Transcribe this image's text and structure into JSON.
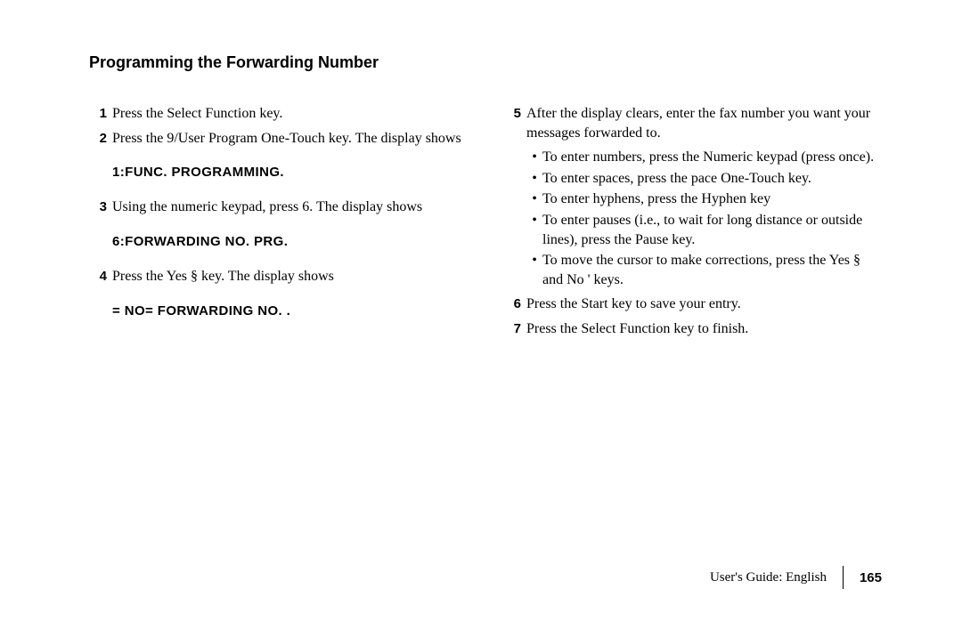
{
  "heading": "Programming the Forwarding Number",
  "left": {
    "steps": [
      {
        "n": "1",
        "t": "Press the Select Function key."
      },
      {
        "n": "2",
        "t": "Press the 9/User Program One-Touch key. The display shows"
      }
    ],
    "display1": "1:FUNC. PROGRAMMING.",
    "step3": {
      "n": "3",
      "t": "Using the numeric keypad, press 6. The display shows"
    },
    "display2": "6:FORWARDING NO. PRG.",
    "step4": {
      "n": "4",
      "t": "Press the Yes §   key. The display shows"
    },
    "display3": "=  NO=   FORWARDING NO.   ."
  },
  "right": {
    "step5": {
      "n": "5",
      "t": "After the display clears, enter the fax number you want your messages forwarded to."
    },
    "bullets": [
      "To enter numbers, press the Numeric keypad (press once).",
      "To enter spaces, press the pace One-Touch key.",
      "To enter hyphens, press the Hyphen key",
      "To enter pauses (i.e., to wait for long distance or outside lines), press the Pause key.",
      "To move the cursor to make corrections, press the Yes §   and No '    keys."
    ],
    "step6": {
      "n": "6",
      "t": "Press the Start key to save your entry."
    },
    "step7": {
      "n": "7",
      "t": "Press the Select Function key to finish."
    }
  },
  "footer": {
    "label": "User's Guide:  English",
    "page": "165"
  }
}
